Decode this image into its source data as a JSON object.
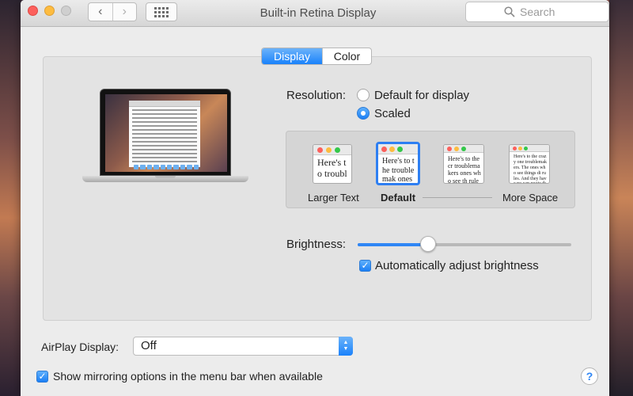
{
  "window": {
    "title": "Built-in Retina Display"
  },
  "toolbar": {
    "back_glyph": "‹",
    "forward_glyph": "›",
    "search_placeholder": "Search"
  },
  "tabs": [
    {
      "label": "Display",
      "selected": true
    },
    {
      "label": "Color",
      "selected": false
    }
  ],
  "resolution": {
    "label": "Resolution:",
    "options": [
      {
        "label": "Default for display",
        "selected": false
      },
      {
        "label": "Scaled",
        "selected": true
      }
    ]
  },
  "scaled_options": [
    {
      "caption": "Larger Text",
      "sample": "Here's to troublem",
      "selected": false
    },
    {
      "caption": "Default",
      "sample": "Here's to the troublemak ones who se rules. And they",
      "selected": true
    },
    {
      "caption": "",
      "sample": "Here's to the cr troublemakers ones who see th rules. And they",
      "selected": false
    },
    {
      "caption": "More Space",
      "sample": "Here's to the crazy one troublemakers. The ones who see things di rules. And they have no can quote them, disag about them. About the Because they change t",
      "selected": false
    }
  ],
  "brightness": {
    "label": "Brightness:",
    "level": 0.33,
    "auto_label": "Automatically adjust brightness",
    "auto_checked": true
  },
  "airplay": {
    "label": "AirPlay Display:",
    "value": "Off"
  },
  "mirroring": {
    "label": "Show mirroring options in the menu bar when available",
    "checked": true
  },
  "help": {
    "glyph": "?"
  },
  "colors": {
    "accent": "#1a82fb",
    "close": "#fc605c",
    "minimize": "#fdbc40",
    "zoom": "#34c84a"
  }
}
